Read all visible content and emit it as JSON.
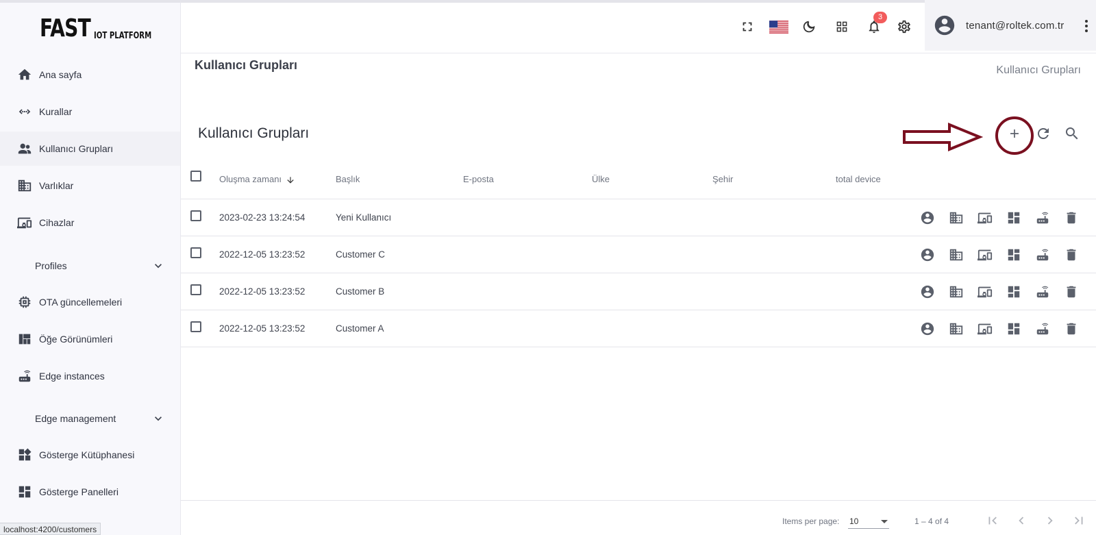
{
  "logo": {
    "main": "FAST",
    "sub": "IOT PLATFORM"
  },
  "sidebar": {
    "items": [
      {
        "label": "Ana sayfa",
        "icon": "home-icon"
      },
      {
        "label": "Kurallar",
        "icon": "rule-chain-icon"
      },
      {
        "label": "Kullanıcı Grupları",
        "icon": "supervisor-icon"
      },
      {
        "label": "Varlıklar",
        "icon": "domain-icon"
      },
      {
        "label": "Cihazlar",
        "icon": "devices-icon"
      },
      {
        "label": "Profiles",
        "icon": "chevron-down-icon"
      },
      {
        "label": "OTA güncellemeleri",
        "icon": "memory-icon"
      },
      {
        "label": "Öğe Görünümleri",
        "icon": "view-quilt-icon"
      },
      {
        "label": "Edge instances",
        "icon": "router-icon"
      },
      {
        "label": "Edge management",
        "icon": "chevron-down-icon"
      },
      {
        "label": "Gösterge Kütüphanesi",
        "icon": "widgets-icon"
      },
      {
        "label": "Gösterge Panelleri",
        "icon": "dashboard-icon"
      }
    ]
  },
  "statusbar": {
    "url": "localhost:4200/customers"
  },
  "header": {
    "notification_count": "3",
    "user_email": "tenant@roltek.com.tr",
    "icons": [
      "fullscreen-icon",
      "us-flag-icon",
      "dark-mode-icon",
      "apps-icon",
      "bell-icon",
      "settings-icon",
      "account-icon",
      "more-vert-icon"
    ]
  },
  "page": {
    "title": "Kullanıcı Grupları",
    "breadcrumb": "Kullanıcı Grupları"
  },
  "card": {
    "title": "Kullanıcı Grupları",
    "actions": [
      "add-icon",
      "refresh-icon",
      "search-icon"
    ]
  },
  "table": {
    "columns": [
      "Oluşma zamanı",
      "Başlık",
      "E-posta",
      "Ülke",
      "Şehir",
      "total device"
    ],
    "rows": [
      {
        "created": "2023-02-23 13:24:54",
        "title": "Yeni Kullanıcı",
        "email": "",
        "country": "",
        "city": "",
        "total": ""
      },
      {
        "created": "2022-12-05 13:23:52",
        "title": "Customer C",
        "email": "",
        "country": "",
        "city": "",
        "total": ""
      },
      {
        "created": "2022-12-05 13:23:52",
        "title": "Customer B",
        "email": "",
        "country": "",
        "city": "",
        "total": ""
      },
      {
        "created": "2022-12-05 13:23:52",
        "title": "Customer A",
        "email": "",
        "country": "",
        "city": "",
        "total": ""
      }
    ],
    "row_actions": [
      "account-circle-icon",
      "domain-icon",
      "devices-icon",
      "dashboard-icon",
      "router-icon",
      "delete-icon"
    ]
  },
  "paginator": {
    "items_per_page_label": "Items per page:",
    "page_size": "10",
    "range": "1 – 4 of 4"
  },
  "colors": {
    "annotation": "#7a1020",
    "badge": "#f25c5c",
    "sidebar_bg": "#f8f8fc"
  }
}
